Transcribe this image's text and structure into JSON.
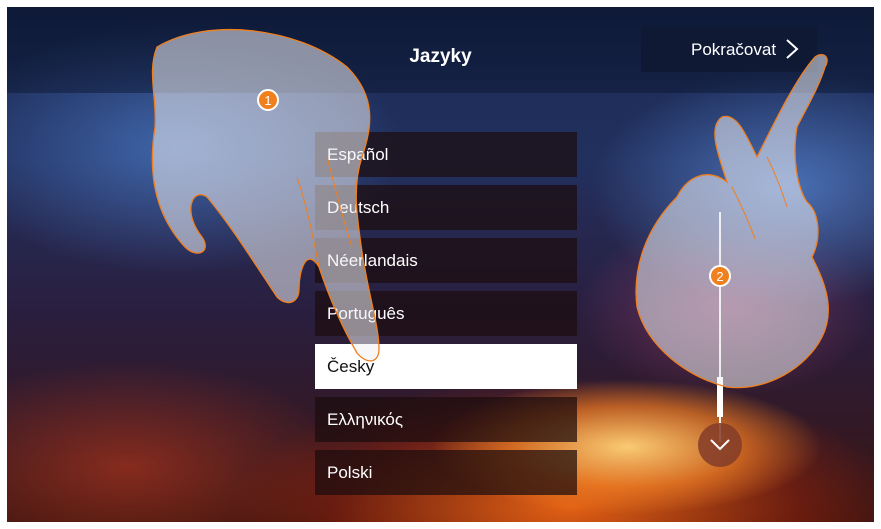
{
  "header": {
    "title": "Jazyky",
    "continue_label": "Pokračovat"
  },
  "languages": [
    {
      "label": "Español",
      "selected": false
    },
    {
      "label": "Deutsch",
      "selected": false
    },
    {
      "label": "Néerlandais",
      "selected": false
    },
    {
      "label": "Português",
      "selected": false
    },
    {
      "label": "Česky",
      "selected": true
    },
    {
      "label": "Ελληνικός",
      "selected": false
    },
    {
      "label": "Polski",
      "selected": false
    }
  ],
  "callouts": {
    "step1": "1",
    "step2": "2"
  },
  "colors": {
    "badge": "#f07f1e",
    "selected_bg": "#ffffff",
    "item_bg": "#1c0c0e"
  },
  "icons": {
    "continue": "chevron-right-icon",
    "scroll": "chevron-down-icon"
  }
}
